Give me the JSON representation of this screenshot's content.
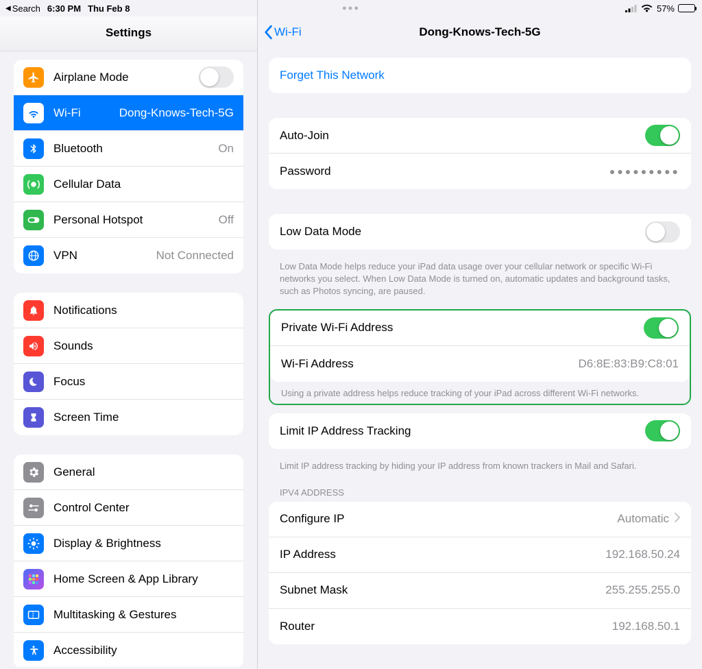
{
  "status": {
    "back_app": "Search",
    "time": "6:30 PM",
    "date": "Thu Feb 8",
    "battery_percent": "57%",
    "battery_fill": 57
  },
  "sidebar": {
    "title": "Settings",
    "g1": {
      "airplane": "Airplane Mode",
      "wifi": "Wi-Fi",
      "wifi_val": "Dong-Knows-Tech-5G",
      "bt": "Bluetooth",
      "bt_val": "On",
      "cell": "Cellular Data",
      "hotspot": "Personal Hotspot",
      "hotspot_val": "Off",
      "vpn": "VPN",
      "vpn_val": "Not Connected"
    },
    "g2": {
      "notif": "Notifications",
      "sounds": "Sounds",
      "focus": "Focus",
      "st": "Screen Time"
    },
    "g3": {
      "general": "General",
      "cc": "Control Center",
      "disp": "Display & Brightness",
      "home": "Home Screen & App Library",
      "multi": "Multitasking & Gestures",
      "acc": "Accessibility"
    }
  },
  "detail": {
    "back_label": "Wi-Fi",
    "title": "Dong-Knows-Tech-5G",
    "forget": "Forget This Network",
    "autojoin": "Auto-Join",
    "password": "Password",
    "password_value": "●●●●●●●●●",
    "lowdata": "Low Data Mode",
    "lowdata_help": "Low Data Mode helps reduce your iPad data usage over your cellular network or specific Wi-Fi networks you select. When Low Data Mode is turned on, automatic updates and background tasks, such as Photos syncing, are paused.",
    "private": "Private Wi-Fi Address",
    "wifiaddr": "Wi-Fi Address",
    "wifiaddr_val": "D6:8E:83:B9:C8:01",
    "private_help": "Using a private address helps reduce tracking of your iPad across different Wi-Fi networks.",
    "limitip": "Limit IP Address Tracking",
    "limitip_help": "Limit IP address tracking by hiding your IP address from known trackers in Mail and Safari.",
    "ipv4_header": "IPV4 ADDRESS",
    "conf": "Configure IP",
    "conf_val": "Automatic",
    "ip": "IP Address",
    "ip_val": "192.168.50.24",
    "mask": "Subnet Mask",
    "mask_val": "255.255.255.0",
    "router": "Router",
    "router_val": "192.168.50.1"
  }
}
